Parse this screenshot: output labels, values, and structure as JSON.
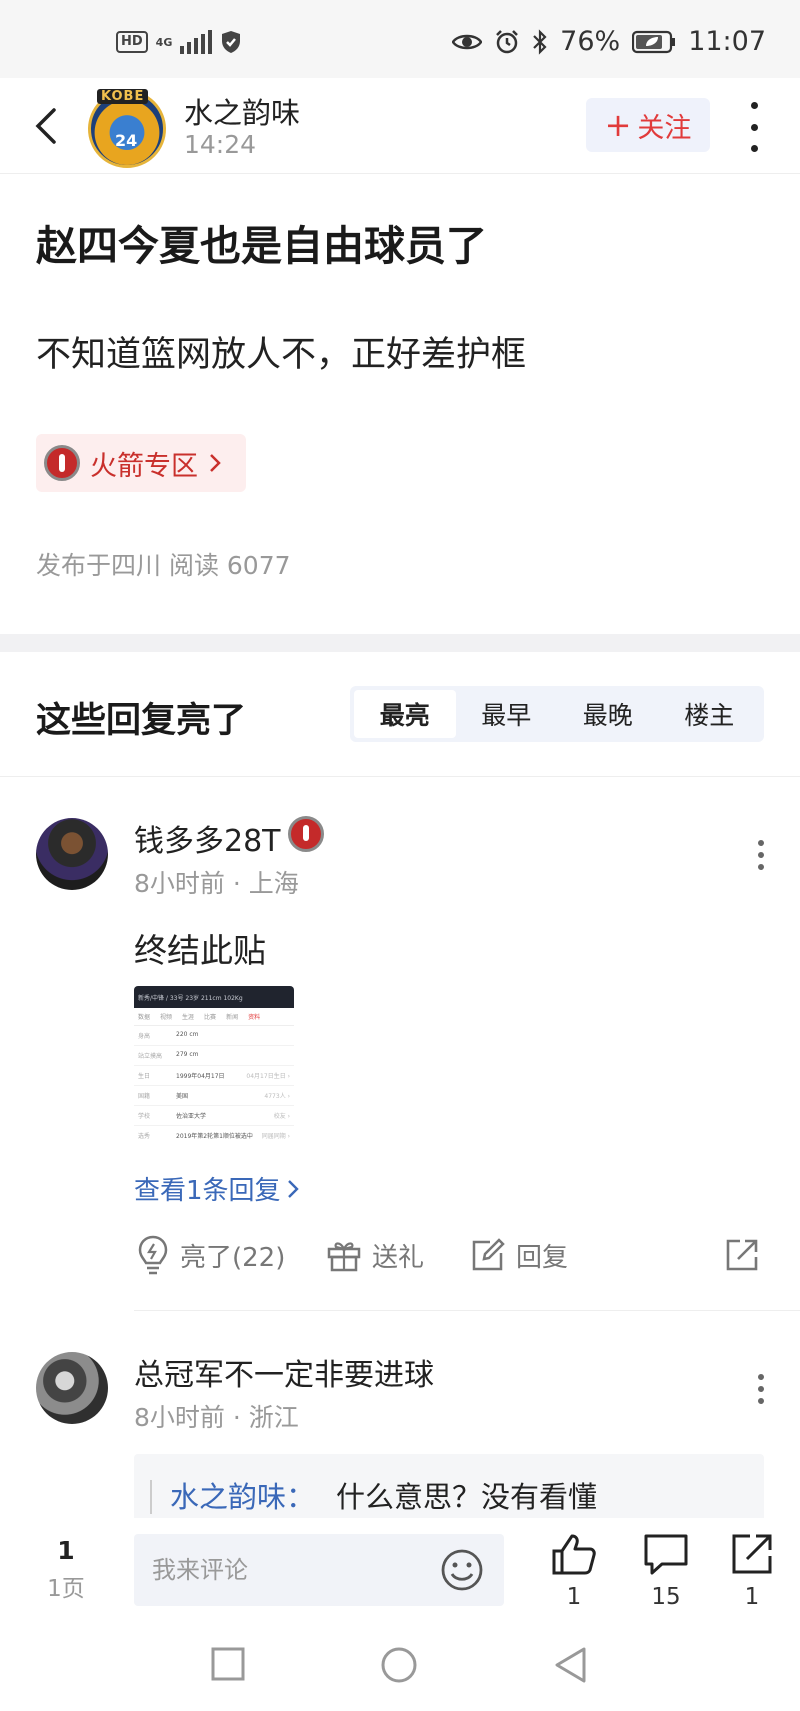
{
  "status_bar": {
    "hd": "HD",
    "network": "4G",
    "battery_pct": "76%",
    "time": "11:07",
    "icons": [
      "hd-icon",
      "signal-icon",
      "shield-icon",
      "eye-icon",
      "alarm-icon",
      "bluetooth-icon",
      "battery-icon"
    ]
  },
  "header": {
    "back_icon": "back-chevron-icon",
    "avatar_badge_text": "KOBE",
    "avatar_number": "24",
    "author_name": "水之韵味",
    "post_time": "14:24",
    "follow_label": "关注",
    "follow_plus": "+",
    "more_icon": "more-vertical-icon"
  },
  "post": {
    "title": "赵四今夏也是自由球员了",
    "body": "不知道篮网放人不，正好差护框",
    "zone_label": "火箭专区",
    "zone_icon": "rockets-logo-icon",
    "meta": "发布于四川  阅读 6077"
  },
  "replies": {
    "section_title": "这些回复亮了",
    "sort_tabs": [
      {
        "label": "最亮",
        "active": true
      },
      {
        "label": "最早",
        "active": false
      },
      {
        "label": "最晚",
        "active": false
      },
      {
        "label": "楼主",
        "active": false
      }
    ],
    "items": [
      {
        "user": "钱多多28T",
        "meta": "8小时前 · 上海",
        "text": "终结此贴",
        "image": {
          "header": "新秀/中锋 / 33号    23岁    211cm    102Kg",
          "tabs": [
            "数据",
            "视频",
            "生涯",
            "比赛",
            "新闻",
            "资料"
          ],
          "active_tab": "资料",
          "rows": [
            {
              "k": "身高",
              "v": "220 cm",
              "r": ""
            },
            {
              "k": "站立摸高",
              "v": "279 cm",
              "r": ""
            },
            {
              "k": "生日",
              "v": "1999年04月17日",
              "r": "04月17日生日 ›"
            },
            {
              "k": "国籍",
              "v": "美国",
              "r": "4773人 ›"
            },
            {
              "k": "学校",
              "v": "佐治亚大学",
              "r": "校友 ›"
            },
            {
              "k": "选秀",
              "v": "2019年第2轮第1顺位被选中",
              "r": "同届同期 ›"
            }
          ]
        },
        "view_replies": "查看1条回复",
        "actions": {
          "like": "亮了(22)",
          "gift": "送礼",
          "reply": "回复"
        }
      },
      {
        "user": "总冠军不一定非要进球",
        "meta": "8小时前 · 浙江",
        "quote_user": "水之韵味：",
        "quote_text": "什么意思？没有看懂"
      }
    ]
  },
  "bottom_bar": {
    "page_number": "1",
    "page_label": "1页",
    "comment_placeholder": "我来评论",
    "like_count": "1",
    "comment_count": "15",
    "share_count": "1"
  },
  "colors": {
    "accent_red": "#e13b3b",
    "link_blue": "#3a68b8",
    "muted": "#999999"
  }
}
